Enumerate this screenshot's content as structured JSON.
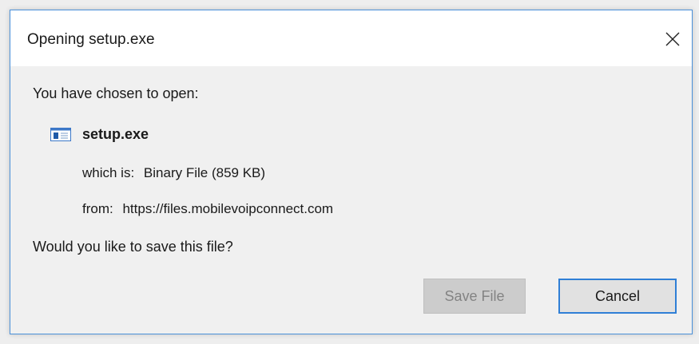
{
  "window": {
    "title": "Opening setup.exe",
    "close_icon": "close-icon"
  },
  "body": {
    "intro": "You have chosen to open:",
    "file_name": "setup.exe",
    "file_icon": "exe-file-icon",
    "which_is_label": "which is:",
    "which_is_value": "Binary File (859 KB)",
    "from_label": "from:",
    "from_value": "https://files.mobilevoipconnect.com",
    "question": "Would you like to save this file?"
  },
  "buttons": {
    "save_label": "Save File",
    "save_disabled": true,
    "cancel_label": "Cancel"
  },
  "colors": {
    "accent": "#2f7fd6",
    "disabled_bg": "#cccccc",
    "disabled_text": "#838383"
  }
}
